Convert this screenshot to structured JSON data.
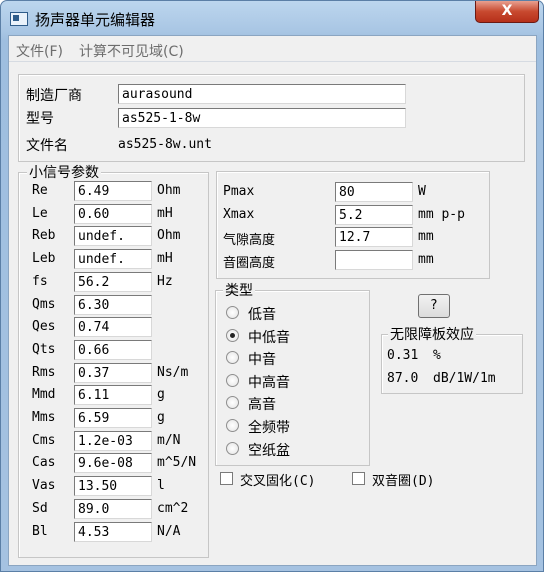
{
  "window": {
    "title": "扬声器单元编辑器",
    "close_label": "X"
  },
  "menubar": {
    "items": [
      "文件(F)",
      "计算不可见域(C)"
    ]
  },
  "header": {
    "manufacturer_label": "制造厂商",
    "manufacturer_value": "aurasound",
    "model_label": "型号",
    "model_value": "as525-1-8w",
    "filename_label": "文件名",
    "filename_value": "as525-8w.unt"
  },
  "small_signal": {
    "title": "小信号参数",
    "params": [
      {
        "label": "Re",
        "value": "6.49",
        "unit": "Ohm"
      },
      {
        "label": "Le",
        "value": "0.60",
        "unit": "mH"
      },
      {
        "label": "Reb",
        "value": "undef.",
        "unit": "Ohm"
      },
      {
        "label": "Leb",
        "value": "undef.",
        "unit": "mH"
      },
      {
        "label": "fs",
        "value": "56.2",
        "unit": "Hz"
      },
      {
        "label": "Qms",
        "value": "6.30",
        "unit": ""
      },
      {
        "label": "Qes",
        "value": "0.74",
        "unit": ""
      },
      {
        "label": "Qts",
        "value": "0.66",
        "unit": ""
      },
      {
        "label": "Rms",
        "value": "0.37",
        "unit": "Ns/m"
      },
      {
        "label": "Mmd",
        "value": "6.11",
        "unit": "g"
      },
      {
        "label": "Mms",
        "value": "6.59",
        "unit": "g"
      },
      {
        "label": "Cms",
        "value": "1.2e-03",
        "unit": "m/N"
      },
      {
        "label": "Cas",
        "value": "9.6e-08",
        "unit": "m^5/N"
      },
      {
        "label": "Vas",
        "value": "13.50",
        "unit": "l"
      },
      {
        "label": "Sd",
        "value": "89.0",
        "unit": "cm^2"
      },
      {
        "label": "Bl",
        "value": "4.53",
        "unit": "N/A"
      }
    ]
  },
  "power": {
    "params": [
      {
        "label": "Pmax",
        "value": "80",
        "unit": "W"
      },
      {
        "label": "Xmax",
        "value": "5.2",
        "unit": "mm p-p"
      },
      {
        "label": "气隙高度",
        "value": "12.7",
        "unit": "mm"
      },
      {
        "label": "音圈高度",
        "value": "",
        "unit": "mm"
      }
    ]
  },
  "type_group": {
    "title": "类型",
    "options": [
      "低音",
      "中低音",
      "中音",
      "中高音",
      "高音",
      "全频带",
      "空纸盆"
    ],
    "selected": "中低音"
  },
  "help_button": {
    "label": "?"
  },
  "baffle": {
    "title": "无限障板效应",
    "v1": "0.31",
    "u1": "%",
    "v2": "87.0",
    "u2": "dB/1W/1m"
  },
  "checkboxes": [
    {
      "label": "交叉固化(C)",
      "checked": false
    },
    {
      "label": "双音圈(D)",
      "checked": false
    }
  ]
}
